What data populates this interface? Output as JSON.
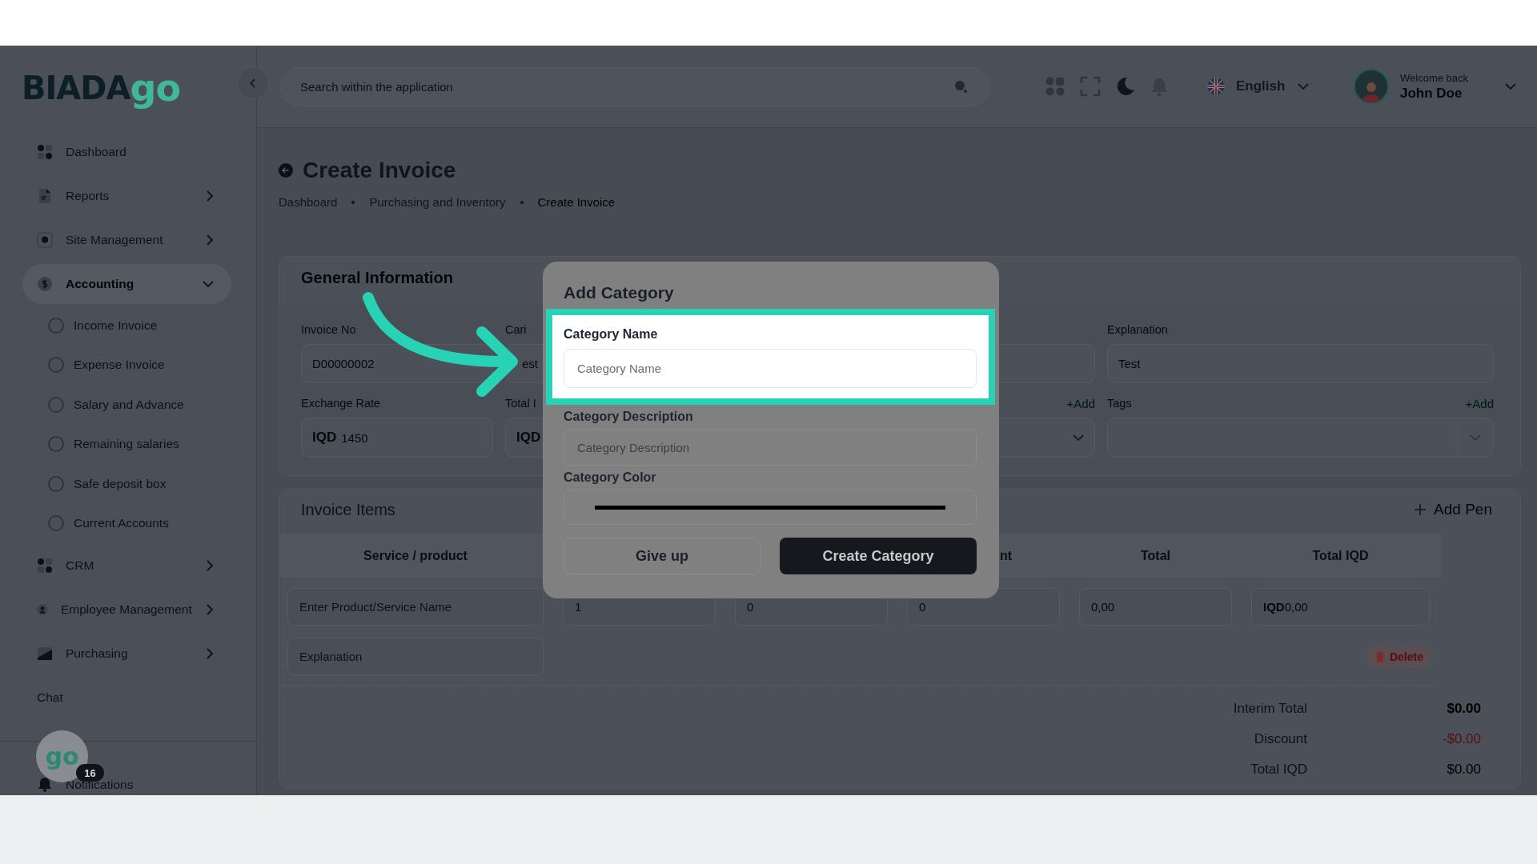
{
  "logo": {
    "text": "BIADA",
    "accent": "go"
  },
  "sidebar": {
    "items": [
      {
        "label": "Dashboard",
        "kind": "link",
        "selected": false
      },
      {
        "label": "Reports",
        "kind": "group",
        "expanded": false,
        "selected": false
      },
      {
        "label": "Site Management",
        "kind": "group",
        "expanded": false,
        "selected": false
      },
      {
        "label": "Accounting",
        "kind": "group",
        "expanded": true,
        "selected": true,
        "children": [
          {
            "label": "Income Invoice",
            "selected": false
          },
          {
            "label": "Expense Invoice",
            "selected": false
          },
          {
            "label": "Salary and Advance",
            "selected": false
          },
          {
            "label": "Remaining salaries",
            "selected": false
          },
          {
            "label": "Safe deposit box",
            "selected": false
          },
          {
            "label": "Current Accounts",
            "selected": false
          }
        ]
      },
      {
        "label": "CRM",
        "kind": "group",
        "expanded": false,
        "selected": false
      },
      {
        "label": "Employee Management",
        "kind": "group",
        "expanded": false,
        "selected": false
      },
      {
        "label": "Purchasing",
        "kind": "group",
        "expanded": false,
        "selected": false
      },
      {
        "label": "Chat",
        "kind": "link",
        "selected": false
      }
    ],
    "assistant": {
      "label": "go",
      "badge": "16"
    },
    "notifications": "Notifications"
  },
  "header": {
    "search": {
      "placeholder": "Search within the application"
    },
    "language": "English",
    "user": {
      "greeting": "Welcome back",
      "name": "John Doe"
    }
  },
  "page": {
    "title": "Create Invoice",
    "breadcrumbs": [
      {
        "label": "Dashboard",
        "selected": false
      },
      {
        "label": "Purchasing and Inventory",
        "selected": false
      },
      {
        "label": "Create Invoice",
        "selected": true
      }
    ]
  },
  "general": {
    "title": "General Information",
    "fields": [
      {
        "kind": "text",
        "label": "Invoice No",
        "value": "D00000002"
      },
      {
        "kind": "text",
        "label": "Cari",
        "value": "est"
      },
      {
        "kind": "text"
      },
      {
        "kind": "text",
        "label": "Explanation",
        "value": "Test"
      },
      {
        "kind": "text",
        "label": "Exchange Rate",
        "prefix": "IQD",
        "value": "1450"
      },
      {
        "kind": "text",
        "label": "Total I",
        "prefix": "IQD"
      },
      {
        "kind": "select",
        "action": "+Add"
      },
      {
        "kind": "multiselect",
        "label": "Tags",
        "action": "+Add"
      }
    ]
  },
  "items": {
    "title": "Invoice Items",
    "add_button": "Add Pen",
    "columns": [
      {
        "kind": "full",
        "label": "Service / product"
      },
      {
        "kind": "hidden"
      },
      {
        "kind": "hidden"
      },
      {
        "kind": "partial",
        "label": "nt"
      },
      {
        "kind": "full",
        "label": "Total"
      },
      {
        "kind": "full",
        "label": "Total IQD"
      }
    ],
    "row": [
      {
        "placeholder": "Enter Product/Service Name"
      },
      {
        "value": "1"
      },
      {
        "value": "0"
      },
      {
        "value": "0"
      },
      {
        "value": "0,00"
      },
      {
        "prefix": "IQD",
        "value": "0,00"
      }
    ],
    "explanation": {
      "placeholder": "Explanation"
    },
    "delete_button": "Delete",
    "totals": [
      {
        "label": "Interim Total",
        "value": "$0.00",
        "kind": "bold"
      },
      {
        "label": "Discount",
        "value": "-$0.00",
        "kind": "negative"
      },
      {
        "label": "Total IQD",
        "value": "$0.00",
        "kind": "plain"
      }
    ]
  },
  "modal": {
    "title": "Add Category",
    "fields": [
      {
        "kind": "text",
        "label": "Category Name",
        "placeholder": "Category Name",
        "highlighted": true
      },
      {
        "kind": "text",
        "label": "Category Description",
        "placeholder": "Category Description",
        "highlighted": false
      },
      {
        "kind": "color",
        "label": "Category Color",
        "highlighted": false
      }
    ],
    "buttons": [
      {
        "label": "Give up",
        "kind": "secondary"
      },
      {
        "label": "Create Category",
        "kind": "primary"
      }
    ]
  }
}
